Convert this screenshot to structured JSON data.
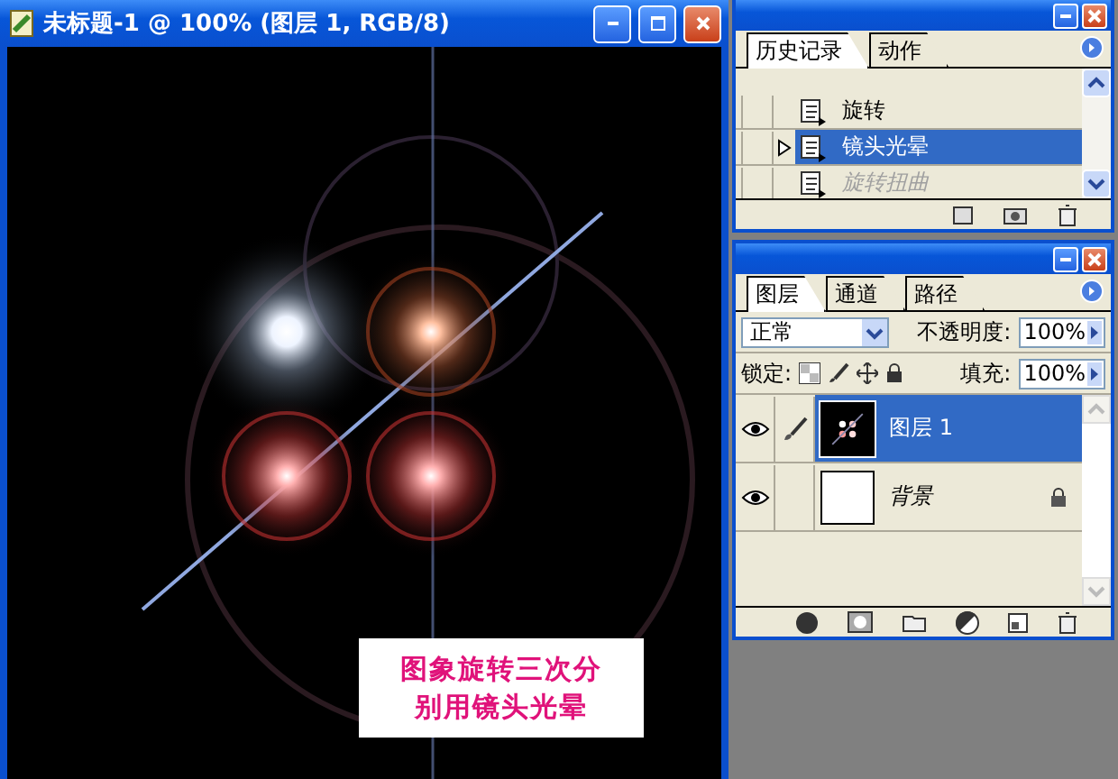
{
  "document_window": {
    "title": "未标题-1 @ 100% (图层 1, RGB/8)",
    "caption_lines": [
      "图象旋转三次分",
      "别用镜头光晕"
    ]
  },
  "history_panel": {
    "tabs": [
      {
        "label": "历史记录",
        "selected": true
      },
      {
        "label": "动作",
        "selected": false
      }
    ],
    "items": [
      {
        "label": "旋转",
        "selected": false,
        "disabled": false,
        "source": false
      },
      {
        "label": "镜头光晕",
        "selected": true,
        "disabled": false,
        "source": false
      },
      {
        "label": "旋转扭曲",
        "selected": false,
        "disabled": true,
        "source": false
      }
    ]
  },
  "layers_panel": {
    "tabs": [
      {
        "label": "图层",
        "selected": true
      },
      {
        "label": "通道",
        "selected": false
      },
      {
        "label": "路径",
        "selected": false
      }
    ],
    "blend_mode": "正常",
    "opacity_label": "不透明度:",
    "opacity": "100%",
    "lock_label": "锁定:",
    "fill_label": "填充:",
    "fill": "100%",
    "layers": [
      {
        "name": "图层 1",
        "kind": "image",
        "selected": true,
        "visible": true,
        "editing": true,
        "locked": false
      },
      {
        "name": "背景",
        "kind": "background",
        "selected": false,
        "visible": true,
        "editing": false,
        "locked": true
      }
    ]
  }
}
